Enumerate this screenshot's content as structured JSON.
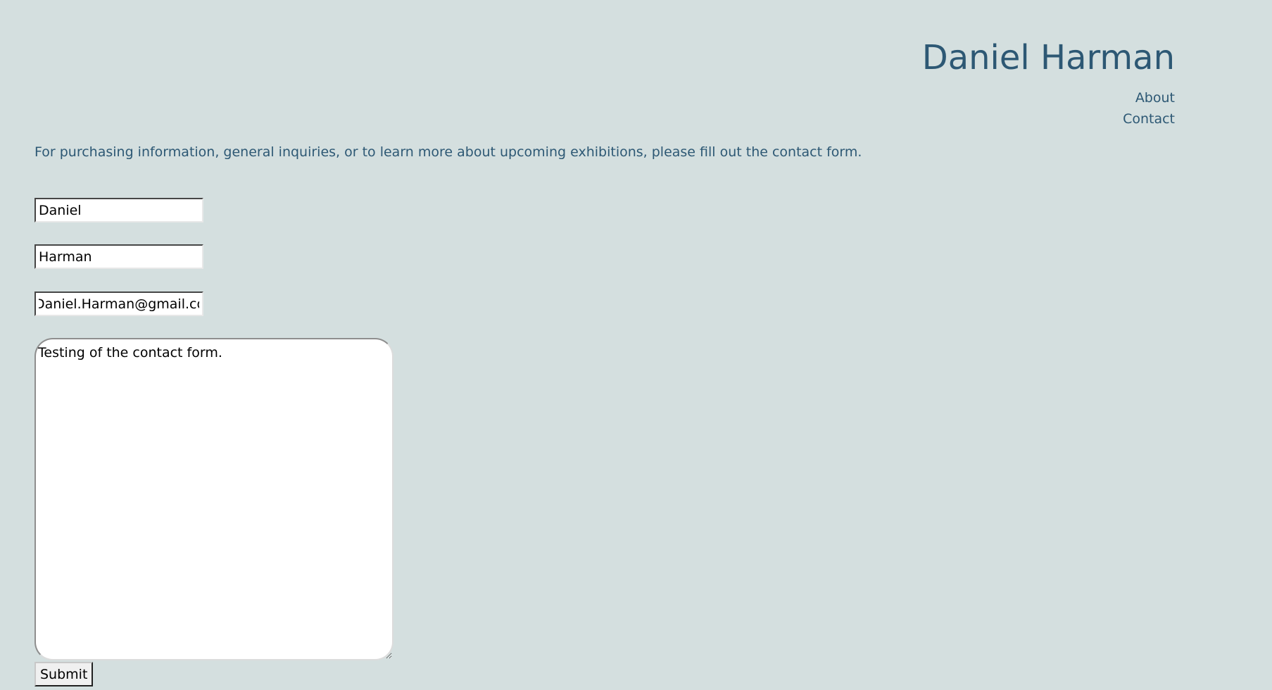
{
  "site": {
    "title": "Daniel Harman"
  },
  "nav": {
    "items": [
      {
        "label": "About"
      },
      {
        "label": "Contact"
      }
    ]
  },
  "intro": {
    "text": "For purchasing information, general inquiries, or to learn more about upcoming exhibitions, please fill out the contact form."
  },
  "form": {
    "first_name": {
      "value": "Daniel"
    },
    "last_name": {
      "value": "Harman"
    },
    "email": {
      "value": "Daniel.Harman@gmail.com"
    },
    "message": {
      "value": "Testing of the contact form."
    },
    "submit_label": "Submit"
  },
  "colors": {
    "background": "#d4dfdf",
    "text": "#2d5874"
  }
}
